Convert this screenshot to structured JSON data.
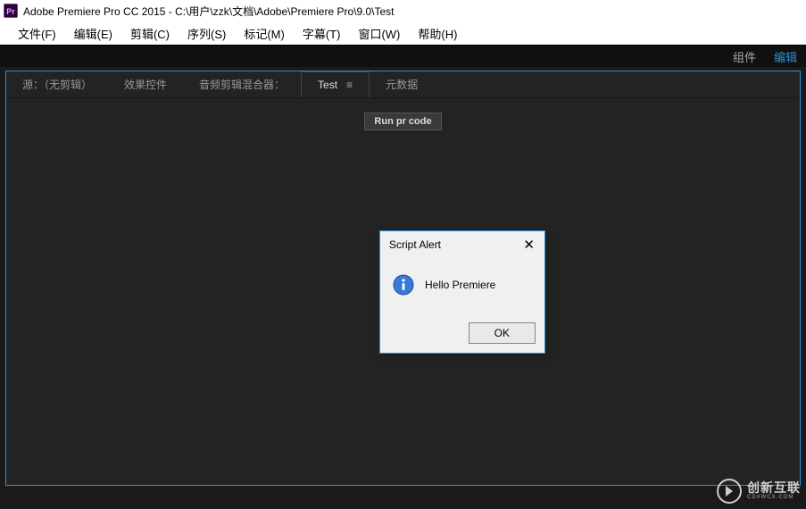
{
  "titlebar": {
    "title": "Adobe Premiere Pro CC 2015 - C:\\用户\\zzk\\文档\\Adobe\\Premiere Pro\\9.0\\Test"
  },
  "menubar": {
    "items": [
      "文件(F)",
      "编辑(E)",
      "剪辑(C)",
      "序列(S)",
      "标记(M)",
      "字幕(T)",
      "窗口(W)",
      "帮助(H)"
    ]
  },
  "workspace_actions": {
    "item0": "组件",
    "item1": "编辑"
  },
  "panel": {
    "tabs": [
      "源：（无剪辑）",
      "效果控件",
      "音频剪辑混合器：",
      "Test",
      "元数据"
    ],
    "active_tab_index": 3,
    "run_button_label": "Run pr code"
  },
  "dialog": {
    "title": "Script Alert",
    "message": "Hello Premiere",
    "ok_label": "OK"
  },
  "watermark": {
    "main": "创新互联",
    "sub": "CDXWCX.COM"
  }
}
